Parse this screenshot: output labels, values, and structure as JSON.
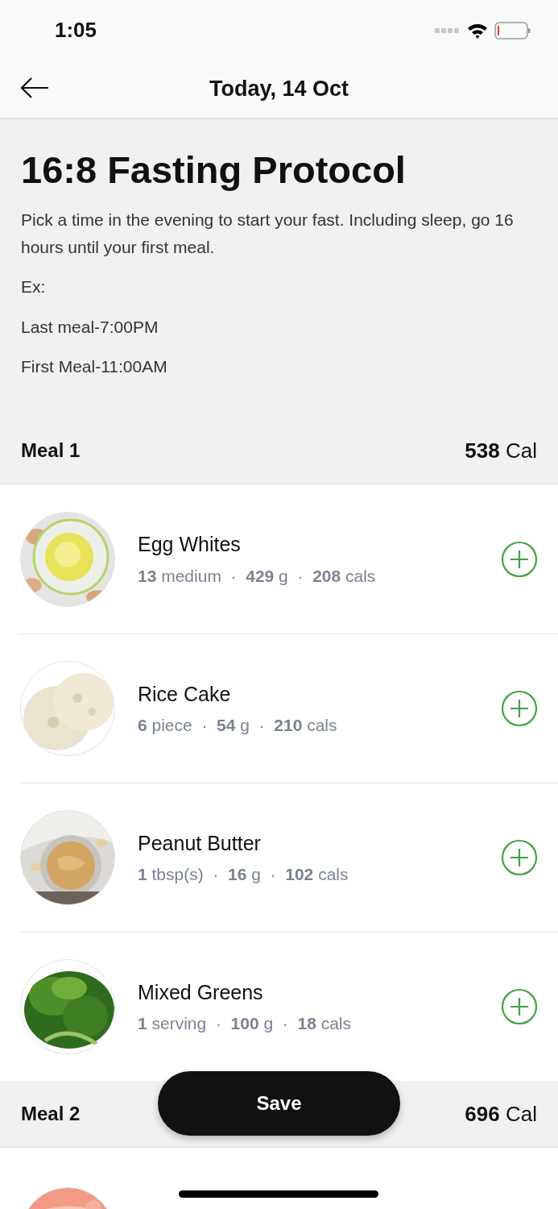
{
  "status_bar": {
    "time": "1:05"
  },
  "header": {
    "title": "Today, 14 Oct"
  },
  "intro": {
    "title": "16:8 Fasting Protocol",
    "paragraphs": [
      "Pick a time in the evening to start your fast. Including sleep, go 16 hours until your first meal.",
      "Ex:",
      "Last meal-7:00PM",
      "First Meal-11:00AM"
    ]
  },
  "meals": [
    {
      "name": "Meal 1",
      "calories": "**538** Cal",
      "items": [
        {
          "kind": "picture",
          "name": "Egg Whites",
          "details": "**13** medium  ·  **429** g  ·  **208** cals"
        },
        {
          "kind": "picture",
          "name": "Rice Cake",
          "details": "**6** piece  ·  **54** g  ·  **210** cals"
        },
        {
          "kind": "picture",
          "name": "Peanut Butter",
          "details": "**1** tbsp(s)  ·  **16** g  ·  **102** cals"
        },
        {
          "kind": "picture",
          "name": "Mixed Greens",
          "details": "**1** serving  ·  **100** g  ·  **18** cals"
        }
      ]
    },
    {
      "name": "Meal 2",
      "calories": "**696** Cal"
    }
  ],
  "save_button": {
    "label": "Save"
  }
}
